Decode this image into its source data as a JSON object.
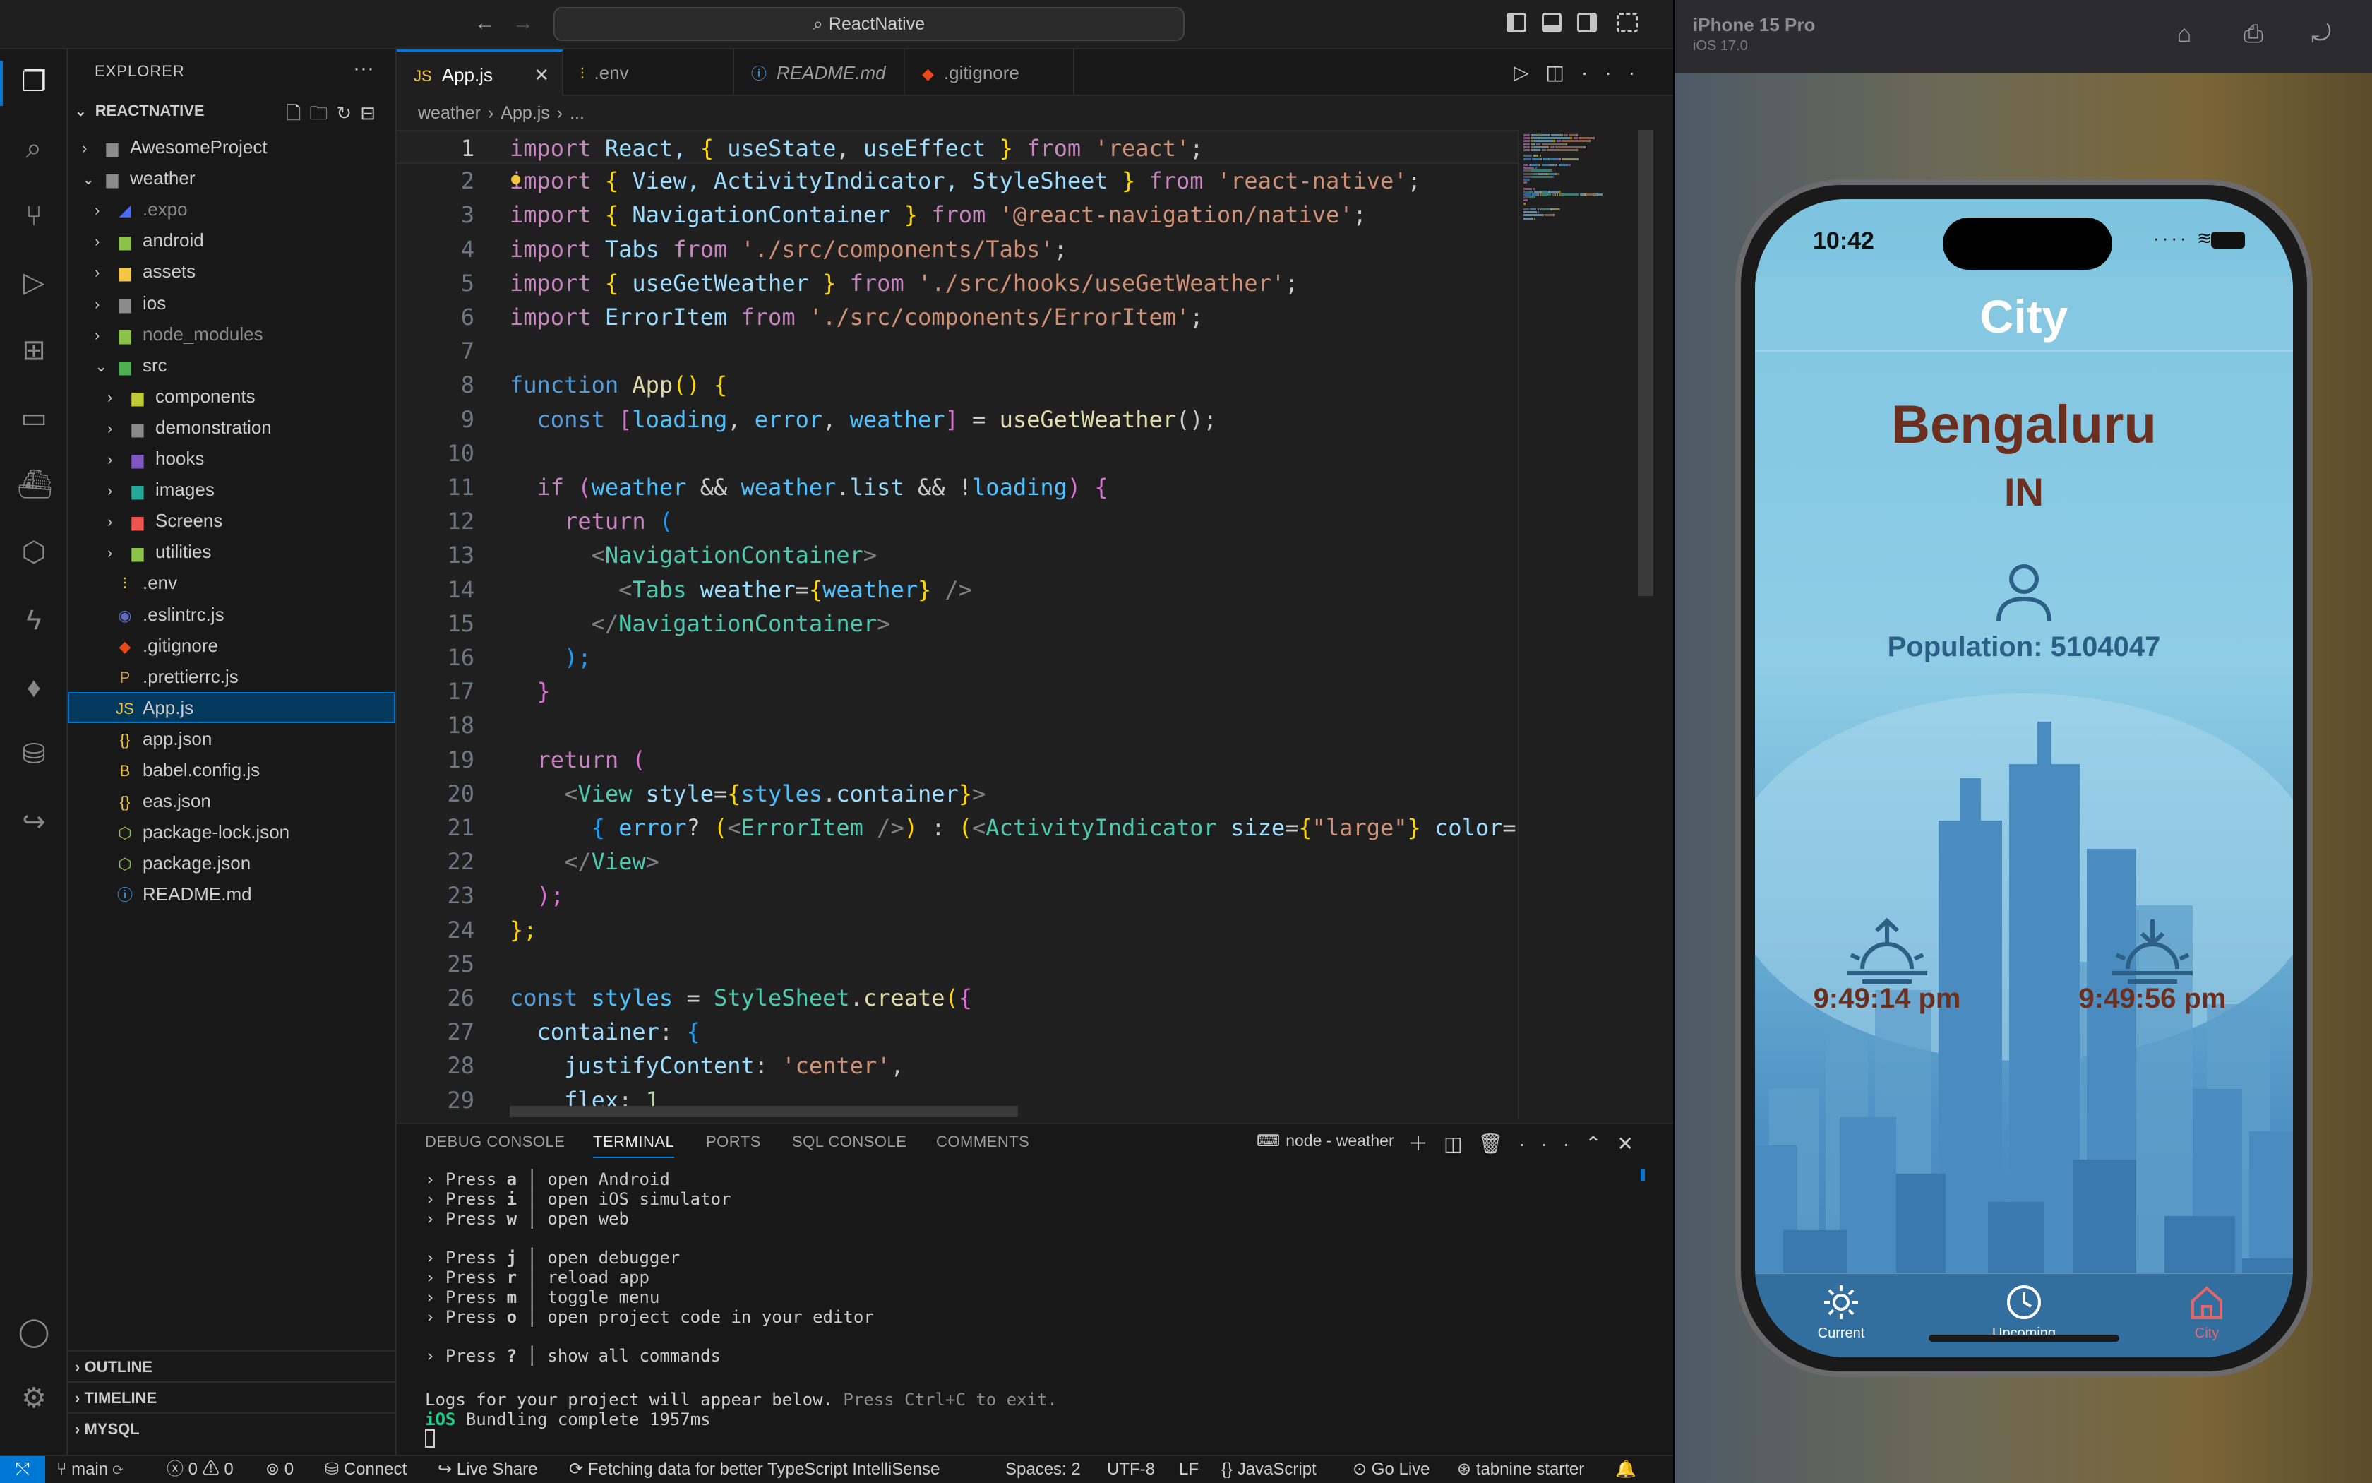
{
  "window": {
    "command_center": "ReactNative"
  },
  "sidebar": {
    "header": "EXPLORER",
    "root": "REACTNATIVE",
    "tree": [
      {
        "label": "AwesomeProject",
        "depth": 1,
        "type": "folder",
        "chevron": "›",
        "icon": "▆",
        "color": "#8a8a8a",
        "dim": false
      },
      {
        "label": "weather",
        "depth": 1,
        "type": "folder",
        "chevron": "⌄",
        "icon": "▆",
        "color": "#8a8a8a",
        "dim": false
      },
      {
        "label": ".expo",
        "depth": 2,
        "type": "folder",
        "chevron": "›",
        "icon": "◢",
        "color": "#4a6cf7",
        "dim": true
      },
      {
        "label": "android",
        "depth": 2,
        "type": "folder",
        "chevron": "›",
        "icon": "▆",
        "color": "#8bc34a",
        "dim": false
      },
      {
        "label": "assets",
        "depth": 2,
        "type": "folder",
        "chevron": "›",
        "icon": "▆",
        "color": "#f4c542",
        "dim": false
      },
      {
        "label": "ios",
        "depth": 2,
        "type": "folder",
        "chevron": "›",
        "icon": "▆",
        "color": "#8a8a8a",
        "dim": false
      },
      {
        "label": "node_modules",
        "depth": 2,
        "type": "folder",
        "chevron": "›",
        "icon": "▆",
        "color": "#8bc34a",
        "dim": true
      },
      {
        "label": "src",
        "depth": 2,
        "type": "folder",
        "chevron": "⌄",
        "icon": "▆",
        "color": "#4caf50",
        "dim": false
      },
      {
        "label": "components",
        "depth": 3,
        "type": "folder",
        "chevron": "›",
        "icon": "▆",
        "color": "#c0ca33",
        "dim": false
      },
      {
        "label": "demonstration",
        "depth": 3,
        "type": "folder",
        "chevron": "›",
        "icon": "▆",
        "color": "#8a8a8a",
        "dim": false
      },
      {
        "label": "hooks",
        "depth": 3,
        "type": "folder",
        "chevron": "›",
        "icon": "▆",
        "color": "#7e57c2",
        "dim": false
      },
      {
        "label": "images",
        "depth": 3,
        "type": "folder",
        "chevron": "›",
        "icon": "▆",
        "color": "#26a69a",
        "dim": false
      },
      {
        "label": "Screens",
        "depth": 3,
        "type": "folder",
        "chevron": "›",
        "icon": "▆",
        "color": "#ef5350",
        "dim": false
      },
      {
        "label": "utilities",
        "depth": 3,
        "type": "folder",
        "chevron": "›",
        "icon": "▆",
        "color": "#8bc34a",
        "dim": false
      },
      {
        "label": ".env",
        "depth": 2,
        "type": "file",
        "chevron": "",
        "icon": "⫶",
        "color": "#f4c542",
        "dim": false
      },
      {
        "label": ".eslintrc.js",
        "depth": 2,
        "type": "file",
        "chevron": "",
        "icon": "◉",
        "color": "#5c6bc0",
        "dim": false
      },
      {
        "label": ".gitignore",
        "depth": 2,
        "type": "file",
        "chevron": "",
        "icon": "◆",
        "color": "#e64a19",
        "dim": false
      },
      {
        "label": ".prettierrc.js",
        "depth": 2,
        "type": "file",
        "chevron": "",
        "icon": "P",
        "color": "#c79a52",
        "dim": false
      },
      {
        "label": "App.js",
        "depth": 2,
        "type": "file",
        "chevron": "",
        "icon": "JS",
        "color": "#f4c542",
        "dim": false
      },
      {
        "label": "app.json",
        "depth": 2,
        "type": "file",
        "chevron": "",
        "icon": "{}",
        "color": "#f4c542",
        "dim": false
      },
      {
        "label": "babel.config.js",
        "depth": 2,
        "type": "file",
        "chevron": "",
        "icon": "B",
        "color": "#f4c542",
        "dim": false
      },
      {
        "label": "eas.json",
        "depth": 2,
        "type": "file",
        "chevron": "",
        "icon": "{}",
        "color": "#f4c542",
        "dim": false
      },
      {
        "label": "package-lock.json",
        "depth": 2,
        "type": "file",
        "chevron": "",
        "icon": "⬡",
        "color": "#8bc34a",
        "dim": false
      },
      {
        "label": "package.json",
        "depth": 2,
        "type": "file",
        "chevron": "",
        "icon": "⬡",
        "color": "#8bc34a",
        "dim": false
      },
      {
        "label": "README.md",
        "depth": 2,
        "type": "file",
        "chevron": "",
        "icon": "ⓘ",
        "color": "#42a5f5",
        "dim": false
      }
    ],
    "selected": "App.js",
    "sections": [
      "OUTLINE",
      "TIMELINE",
      "MYSQL"
    ]
  },
  "editor": {
    "tabs": [
      {
        "label": "App.js",
        "icon": "JS",
        "color": "#f4c542",
        "active": true,
        "italic": false
      },
      {
        "label": ".env",
        "icon": "⫶",
        "color": "#f4c542",
        "active": false,
        "italic": false
      },
      {
        "label": "README.md",
        "icon": "ⓘ",
        "color": "#42a5f5",
        "active": false,
        "italic": true
      },
      {
        "label": ".gitignore",
        "icon": "◆",
        "color": "#e64a19",
        "active": false,
        "italic": false
      }
    ],
    "breadcrumb": [
      "weather",
      "App.js",
      "..."
    ],
    "current_line": 1,
    "code": [
      [
        [
          "import ",
          "#c586c0"
        ],
        [
          "React, ",
          "#9cdcfe"
        ],
        [
          "{ ",
          "#ffd700"
        ],
        [
          "useState",
          "#9cdcfe"
        ],
        [
          ", ",
          "#cccccc"
        ],
        [
          "useEffect",
          "#9cdcfe"
        ],
        [
          " } ",
          "#ffd700"
        ],
        [
          "from ",
          "#c586c0"
        ],
        [
          "'react'",
          "#ce9178"
        ],
        [
          ";",
          "#cccccc"
        ]
      ],
      [
        [
          "import ",
          "#c586c0"
        ],
        [
          "{ ",
          "#ffd700"
        ],
        [
          "View, ActivityIndicator, StyleSheet",
          "#9cdcfe"
        ],
        [
          " } ",
          "#ffd700"
        ],
        [
          "from ",
          "#c586c0"
        ],
        [
          "'react-native'",
          "#ce9178"
        ],
        [
          ";",
          "#cccccc"
        ]
      ],
      [
        [
          "import ",
          "#c586c0"
        ],
        [
          "{ ",
          "#ffd700"
        ],
        [
          "NavigationContainer",
          "#9cdcfe"
        ],
        [
          " } ",
          "#ffd700"
        ],
        [
          "from ",
          "#c586c0"
        ],
        [
          "'@react-navigation/native'",
          "#ce9178"
        ],
        [
          ";",
          "#cccccc"
        ]
      ],
      [
        [
          "import ",
          "#c586c0"
        ],
        [
          "Tabs ",
          "#9cdcfe"
        ],
        [
          "from ",
          "#c586c0"
        ],
        [
          "'./src/components/Tabs'",
          "#ce9178"
        ],
        [
          ";",
          "#cccccc"
        ]
      ],
      [
        [
          "import ",
          "#c586c0"
        ],
        [
          "{ ",
          "#ffd700"
        ],
        [
          "useGetWeather",
          "#9cdcfe"
        ],
        [
          " } ",
          "#ffd700"
        ],
        [
          "from ",
          "#c586c0"
        ],
        [
          "'./src/hooks/useGetWeather'",
          "#ce9178"
        ],
        [
          ";",
          "#cccccc"
        ]
      ],
      [
        [
          "import ",
          "#c586c0"
        ],
        [
          "ErrorItem ",
          "#9cdcfe"
        ],
        [
          "from ",
          "#c586c0"
        ],
        [
          "'./src/components/ErrorItem'",
          "#ce9178"
        ],
        [
          ";",
          "#cccccc"
        ]
      ],
      [],
      [
        [
          "function ",
          "#569cd6"
        ],
        [
          "App",
          "#dcdcaa"
        ],
        [
          "() ",
          "#ffd700"
        ],
        [
          "{",
          "#ffd700"
        ]
      ],
      [
        [
          "  const ",
          "#569cd6"
        ],
        [
          "[",
          "#da70d6"
        ],
        [
          "loading",
          "#4fc1ff"
        ],
        [
          ", ",
          "#cccccc"
        ],
        [
          "error",
          "#4fc1ff"
        ],
        [
          ", ",
          "#cccccc"
        ],
        [
          "weather",
          "#4fc1ff"
        ],
        [
          "] ",
          "#da70d6"
        ],
        [
          "= ",
          "#cccccc"
        ],
        [
          "useGetWeather",
          "#dcdcaa"
        ],
        [
          "();",
          "#cccccc"
        ]
      ],
      [],
      [
        [
          "  if ",
          "#c586c0"
        ],
        [
          "(",
          "#da70d6"
        ],
        [
          "weather ",
          "#4fc1ff"
        ],
        [
          "&& ",
          "#cccccc"
        ],
        [
          "weather",
          "#4fc1ff"
        ],
        [
          ".",
          "#cccccc"
        ],
        [
          "list ",
          "#9cdcfe"
        ],
        [
          "&& ",
          "#cccccc"
        ],
        [
          "!",
          "#cccccc"
        ],
        [
          "loading",
          "#4fc1ff"
        ],
        [
          ") ",
          "#da70d6"
        ],
        [
          "{",
          "#da70d6"
        ]
      ],
      [
        [
          "    return ",
          "#c586c0"
        ],
        [
          "(",
          "#179fff"
        ]
      ],
      [
        [
          "      <",
          "#808080"
        ],
        [
          "NavigationContainer",
          "#4ec9b0"
        ],
        [
          ">",
          "#808080"
        ]
      ],
      [
        [
          "        <",
          "#808080"
        ],
        [
          "Tabs ",
          "#4ec9b0"
        ],
        [
          "weather",
          "#9cdcfe"
        ],
        [
          "=",
          "#cccccc"
        ],
        [
          "{",
          "#ffd700"
        ],
        [
          "weather",
          "#4fc1ff"
        ],
        [
          "} ",
          "#ffd700"
        ],
        [
          "/>",
          "#808080"
        ]
      ],
      [
        [
          "      </",
          "#808080"
        ],
        [
          "NavigationContainer",
          "#4ec9b0"
        ],
        [
          ">",
          "#808080"
        ]
      ],
      [
        [
          "    );",
          "#179fff"
        ]
      ],
      [
        [
          "  }",
          "#da70d6"
        ]
      ],
      [],
      [
        [
          "  return ",
          "#c586c0"
        ],
        [
          "(",
          "#da70d6"
        ]
      ],
      [
        [
          "    <",
          "#808080"
        ],
        [
          "View ",
          "#4ec9b0"
        ],
        [
          "style",
          "#9cdcfe"
        ],
        [
          "=",
          "#cccccc"
        ],
        [
          "{",
          "#ffd700"
        ],
        [
          "styles",
          "#4fc1ff"
        ],
        [
          ".",
          "#cccccc"
        ],
        [
          "container",
          "#9cdcfe"
        ],
        [
          "}",
          "#ffd700"
        ],
        [
          ">",
          "#808080"
        ]
      ],
      [
        [
          "      { ",
          "#179fff"
        ],
        [
          "error",
          "#4fc1ff"
        ],
        [
          "? ",
          "#cccccc"
        ],
        [
          "(",
          "#ffd700"
        ],
        [
          "<",
          "#808080"
        ],
        [
          "ErrorItem ",
          "#4ec9b0"
        ],
        [
          "/>",
          "#808080"
        ],
        [
          ") ",
          "#ffd700"
        ],
        [
          ": ",
          "#cccccc"
        ],
        [
          "(",
          "#ffd700"
        ],
        [
          "<",
          "#808080"
        ],
        [
          "ActivityIndicator ",
          "#4ec9b0"
        ],
        [
          "size",
          "#9cdcfe"
        ],
        [
          "=",
          "#cccccc"
        ],
        [
          "{",
          "#ffd700"
        ],
        [
          "\"large\"",
          "#ce9178"
        ],
        [
          "} ",
          "#ffd700"
        ],
        [
          "color",
          "#9cdcfe"
        ],
        [
          "=",
          "#cccccc"
        ]
      ],
      [
        [
          "    </",
          "#808080"
        ],
        [
          "View",
          "#4ec9b0"
        ],
        [
          ">",
          "#808080"
        ]
      ],
      [
        [
          "  );",
          "#da70d6"
        ]
      ],
      [
        [
          "};",
          "#ffd700"
        ]
      ],
      [],
      [
        [
          "const ",
          "#569cd6"
        ],
        [
          "styles ",
          "#4fc1ff"
        ],
        [
          "= ",
          "#cccccc"
        ],
        [
          "StyleSheet",
          "#4ec9b0"
        ],
        [
          ".",
          "#cccccc"
        ],
        [
          "create",
          "#dcdcaa"
        ],
        [
          "(",
          "#ffd700"
        ],
        [
          "{",
          "#da70d6"
        ]
      ],
      [
        [
          "  container",
          "#9cdcfe"
        ],
        [
          ": ",
          "#cccccc"
        ],
        [
          "{",
          "#179fff"
        ]
      ],
      [
        [
          "    justifyContent",
          "#9cdcfe"
        ],
        [
          ": ",
          "#cccccc"
        ],
        [
          "'center'",
          "#ce9178"
        ],
        [
          ",",
          "#cccccc"
        ]
      ],
      [
        [
          "    flex",
          "#9cdcfe"
        ],
        [
          ": ",
          "#cccccc"
        ],
        [
          "1",
          "#b5cea8"
        ]
      ]
    ],
    "line21_tail": "/>"
  },
  "panel": {
    "tabs": [
      "DEBUG CONSOLE",
      "TERMINAL",
      "PORTS",
      "SQL CONSOLE",
      "COMMENTS"
    ],
    "active_tab": "TERMINAL",
    "terminal_title": "node - weather",
    "terminal_lines": [
      [
        "› Press ",
        "a",
        " │ open Android"
      ],
      [
        "› Press ",
        "i",
        " │ open iOS simulator"
      ],
      [
        "› Press ",
        "w",
        " │ open web"
      ],
      [
        "",
        "",
        ""
      ],
      [
        "› Press ",
        "j",
        " │ open debugger"
      ],
      [
        "› Press ",
        "r",
        " │ reload app"
      ],
      [
        "› Press ",
        "m",
        " │ toggle menu"
      ],
      [
        "› Press ",
        "o",
        " │ open project code in your editor"
      ],
      [
        "",
        "",
        ""
      ],
      [
        "› Press ",
        "?",
        " │ show all commands"
      ]
    ],
    "log_line": "Logs for your project will appear below.",
    "log_hint": " Press Ctrl+C to exit.",
    "bundle_prefix": "iOS",
    "bundle_text": " Bundling complete 1957ms"
  },
  "statusbar": {
    "branch": "main",
    "errors": "0",
    "warnings": "0",
    "ports": "0",
    "connect": "Connect",
    "live_share": "Live Share",
    "fetching": "Fetching data for better TypeScript IntelliSense",
    "spaces": "Spaces: 2",
    "encoding": "UTF-8",
    "eol": "LF",
    "language": "JavaScript",
    "go_live": "Go Live",
    "tabnine": "tabnine starter"
  },
  "simulator": {
    "device": "iPhone 15 Pro",
    "os": "iOS 17.0",
    "time": "10:42",
    "screen_title": "City",
    "city": "Bengaluru",
    "country": "IN",
    "population": "Population: 5104047",
    "sunrise": "9:49:14 pm",
    "sunset": "9:49:56 pm",
    "tabs": [
      {
        "label": "Current",
        "icon": "sun-icon",
        "active": false
      },
      {
        "label": "Upcoming",
        "icon": "clock-icon",
        "active": false
      },
      {
        "label": "City",
        "icon": "home-icon",
        "active": true
      }
    ],
    "colors": {
      "accent": "#e2676a",
      "city_text": "#6b2f1f",
      "tabbar": "#336f9e",
      "population": "#2c5f86"
    }
  }
}
